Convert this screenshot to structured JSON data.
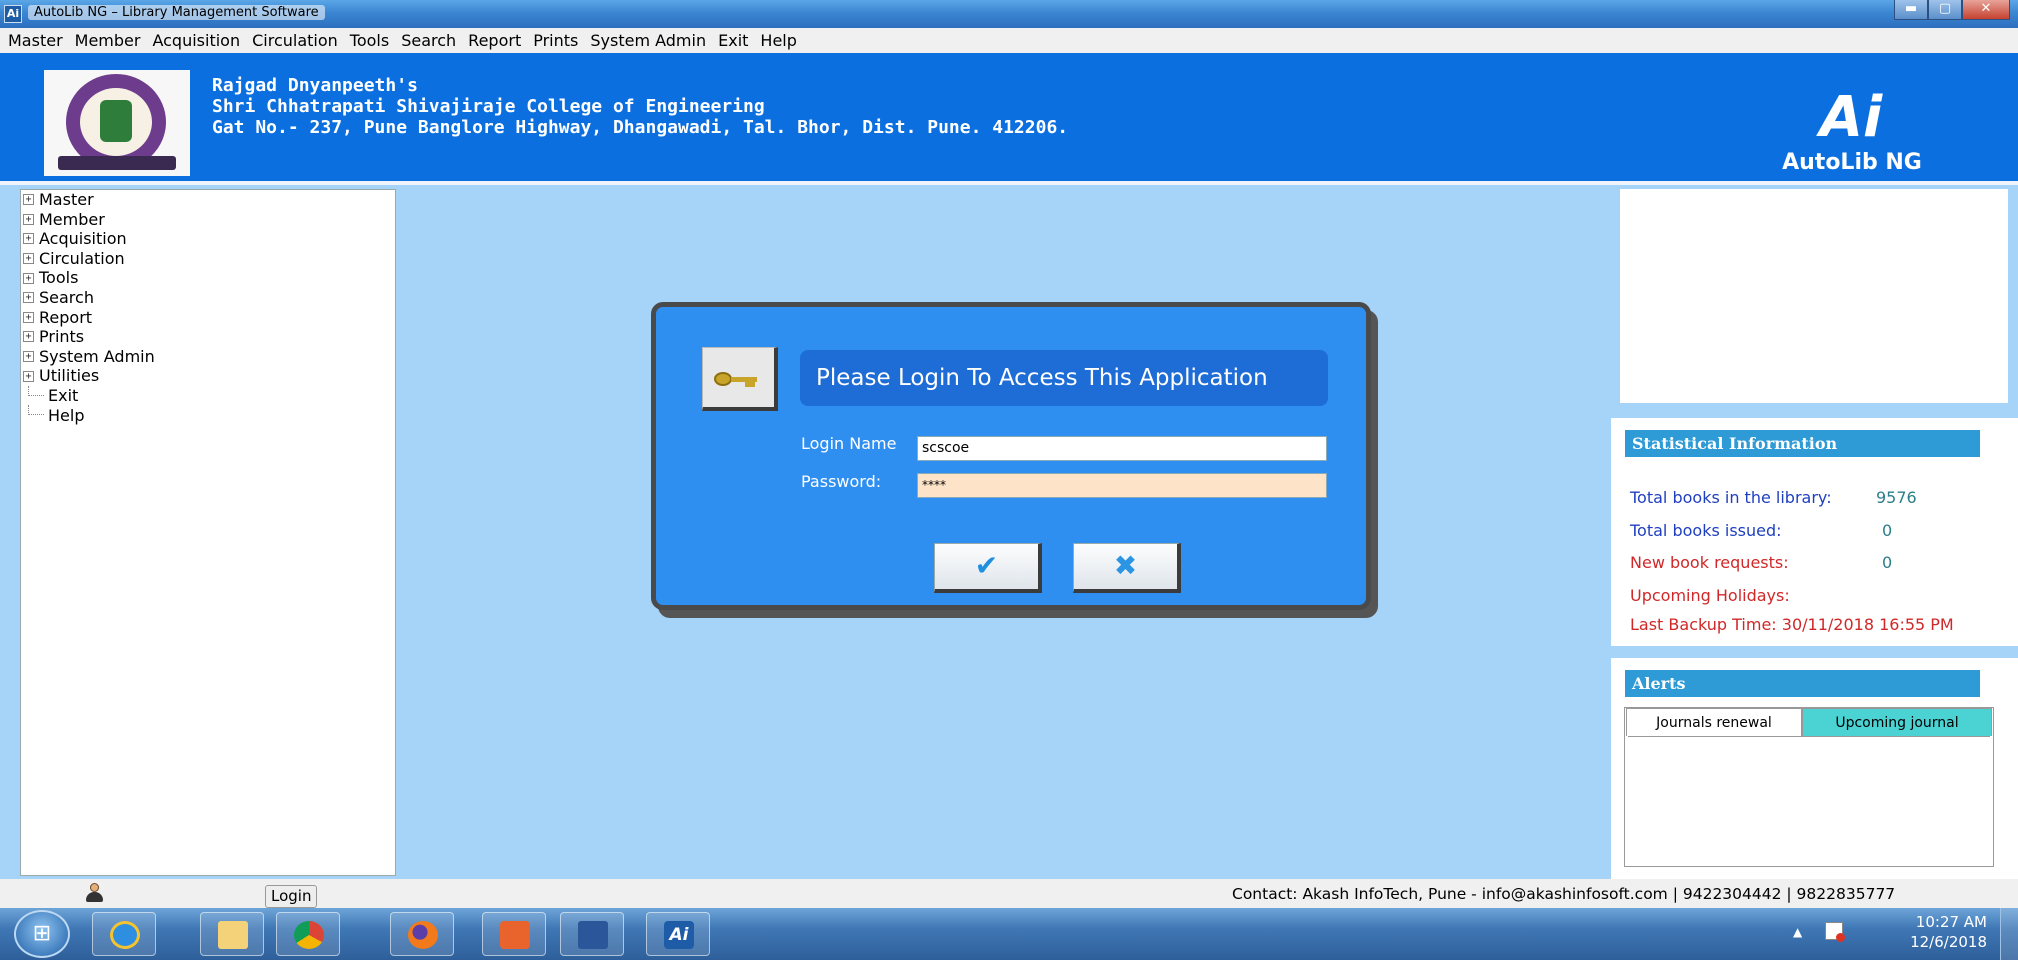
{
  "window": {
    "title": "AutoLib NG – Library Management Software"
  },
  "menubar": [
    "Master",
    "Member",
    "Acquisition",
    "Circulation",
    "Tools",
    "Search",
    "Report",
    "Prints",
    "System Admin",
    "Exit",
    "Help"
  ],
  "header": {
    "line1": "Rajgad Dnyanpeeth's",
    "line2": "Shri Chhatrapati Shivajiraje College of Engineering",
    "line3": "Gat No.- 237, Pune Banglore Highway, Dhangawadi, Tal. Bhor, Dist. Pune. 412206.",
    "brand_mark": "Ai",
    "brand_name": "AutoLib NG"
  },
  "sidebar": {
    "items": [
      {
        "label": "Master",
        "expandable": true
      },
      {
        "label": "Member",
        "expandable": true
      },
      {
        "label": "Acquisition",
        "expandable": true
      },
      {
        "label": "Circulation",
        "expandable": true
      },
      {
        "label": "Tools",
        "expandable": true
      },
      {
        "label": "Search",
        "expandable": true
      },
      {
        "label": "Report",
        "expandable": true
      },
      {
        "label": "Prints",
        "expandable": true
      },
      {
        "label": "System Admin",
        "expandable": true
      },
      {
        "label": "Utilities",
        "expandable": true
      },
      {
        "label": "Exit",
        "expandable": false
      },
      {
        "label": "Help",
        "expandable": false
      }
    ]
  },
  "login": {
    "title": "Please Login To Access This Application",
    "login_name_label": "Login Name",
    "login_name_value": "scscoe",
    "password_label": "Password:",
    "password_value": "****",
    "ok_icon": "✔",
    "cancel_icon": "✖"
  },
  "stats": {
    "heading": "Statistical Information",
    "total_books_label": "Total books in the library:",
    "total_books_value": "9576",
    "issued_label": "Total books issued:",
    "issued_value": "0",
    "requests_label": "New book requests:",
    "requests_value": "0",
    "holidays_label": "Upcoming Holidays:",
    "backup_label": "Last Backup Time: 30/11/2018 16:55 PM"
  },
  "alerts": {
    "heading": "Alerts",
    "tabs": [
      "Journals renewal",
      "Upcoming journal"
    ]
  },
  "statusbar": {
    "login_label": "Login",
    "contact": "Contact: Akash InfoTech, Pune - info@akashinfosoft.com | 9422304442 | 9822835777"
  },
  "taskbar": {
    "time": "10:27 AM",
    "date": "12/6/2018",
    "apps": [
      "internet-explorer-icon",
      "file-explorer-icon",
      "chrome-icon",
      "firefox-icon",
      "media-player-icon",
      "word-icon",
      "autolib-icon"
    ]
  },
  "colors": {
    "banner": "#0b6fe0",
    "workspace": "#a6d3f8",
    "dialog": "#2e8ff0",
    "panel_head": "#2e9ad6",
    "stat_blue": "#1f3fc0",
    "stat_red": "#d02828",
    "stat_value": "#2b7f8a"
  }
}
